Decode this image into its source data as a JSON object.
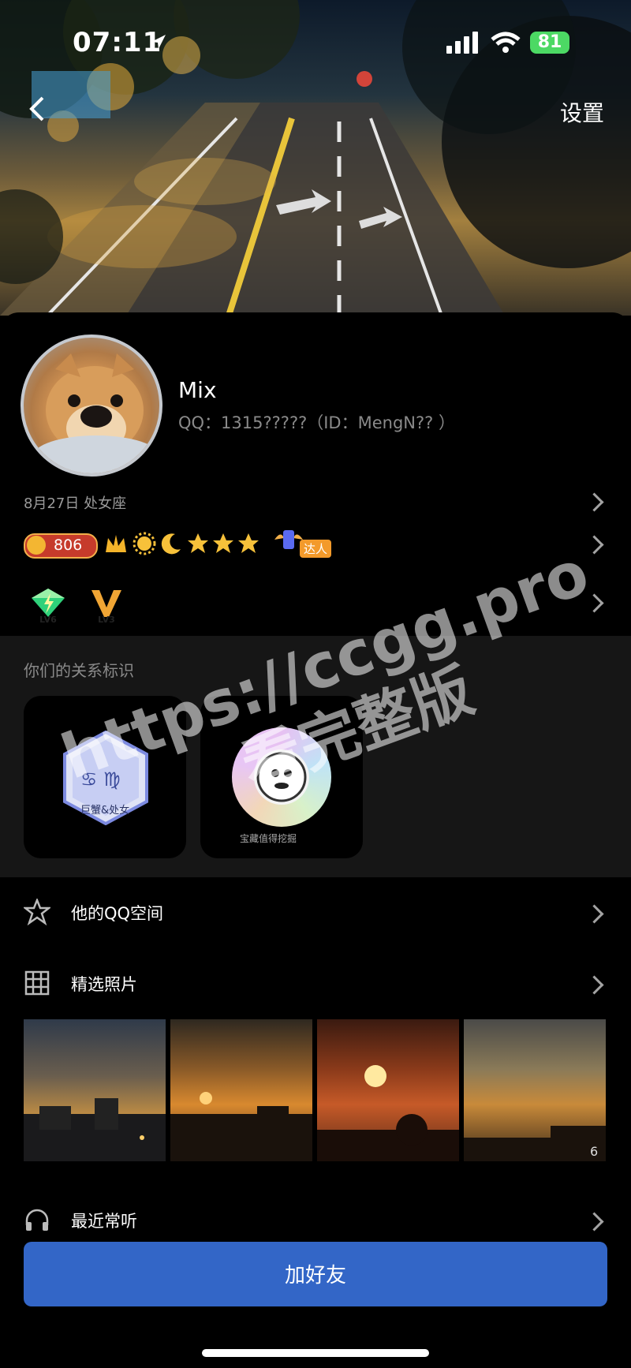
{
  "status_bar": {
    "time": "07:11",
    "battery": "81"
  },
  "header": {
    "settings_label": "设置"
  },
  "profile": {
    "name": "Mix",
    "qq_line": "QQ：1315?????（ID：MengN?? ）",
    "birthday": "8月27日 处女座",
    "coins": "806",
    "daren_tag": "达人",
    "levels": [
      "LV6",
      "LV3"
    ]
  },
  "relation": {
    "title": "你们的关系标识",
    "cards": [
      {
        "label": "巨蟹&处女",
        "symbols": "♋ ♍"
      },
      {
        "label": "宝藏值得挖掘"
      }
    ]
  },
  "menu": {
    "qzone_label": "他的QQ空间",
    "photos_label": "精选照片",
    "photos_count": "6",
    "music_label": "最近常听"
  },
  "action": {
    "add_friend_label": "加好友"
  },
  "watermark": {
    "line1": "https://ccgg.pro",
    "line2": "看完整版"
  },
  "colors": {
    "button_blue": "#3366c7",
    "battery_green": "#4cd964",
    "background": "#000000",
    "section_gray": "#161616"
  }
}
